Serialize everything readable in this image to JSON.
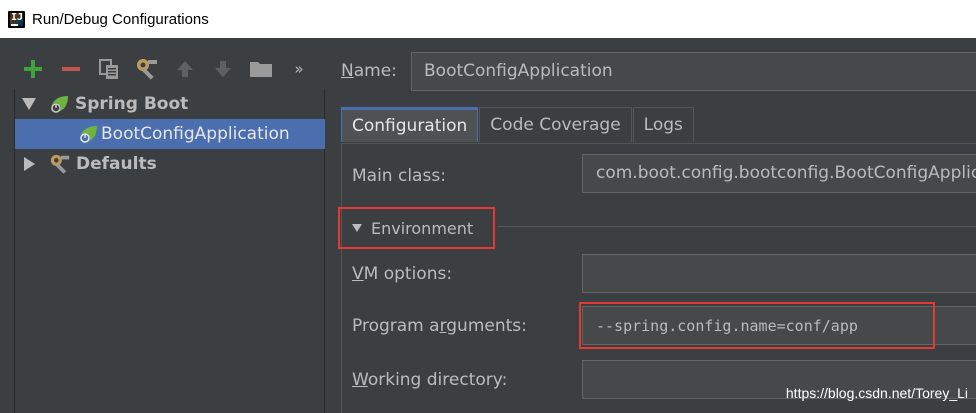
{
  "window": {
    "title": "Run/Debug Configurations"
  },
  "toolbar": {
    "buttons": [
      {
        "icon": "plus-icon",
        "color": "#3fa33f"
      },
      {
        "icon": "minus-icon",
        "color": "#c75450"
      },
      {
        "icon": "copy-icon"
      },
      {
        "icon": "wrench-icon"
      },
      {
        "icon": "arrow-up-icon"
      },
      {
        "icon": "arrow-down-icon"
      },
      {
        "icon": "folder-icon"
      },
      {
        "icon": "more-chevron-icon",
        "label": "»"
      }
    ]
  },
  "tree": {
    "spring_boot": "Spring Boot",
    "app": "BootConfigApplication",
    "defaults": "Defaults"
  },
  "form": {
    "name_label_underlined": "N",
    "name_label_rest": "ame:",
    "name_value": "BootConfigApplication",
    "tabs": [
      "Configuration",
      "Code Coverage",
      "Logs"
    ],
    "main_class_label": "Main class:",
    "main_class_value": "com.boot.config.bootconfig.BootConfigApplication",
    "environment_label": "Environment",
    "vm_options_label_underlined": "V",
    "vm_options_label_rest": "M options:",
    "vm_options_value": "",
    "program_args_label_pre": "Program a",
    "program_args_label_underlined": "r",
    "program_args_label_post": "guments:",
    "program_args_value": "--spring.config.name=conf/app",
    "working_dir_label_underlined": "W",
    "working_dir_label_rest": "orking directory:",
    "working_dir_value": ""
  },
  "watermark": "https://blog.csdn.net/Torey_Li",
  "colors": {
    "background": "#3c3f41",
    "selection": "#4b6eaf",
    "highlight_border": "#e53935",
    "spring_green": "#6db33f"
  }
}
